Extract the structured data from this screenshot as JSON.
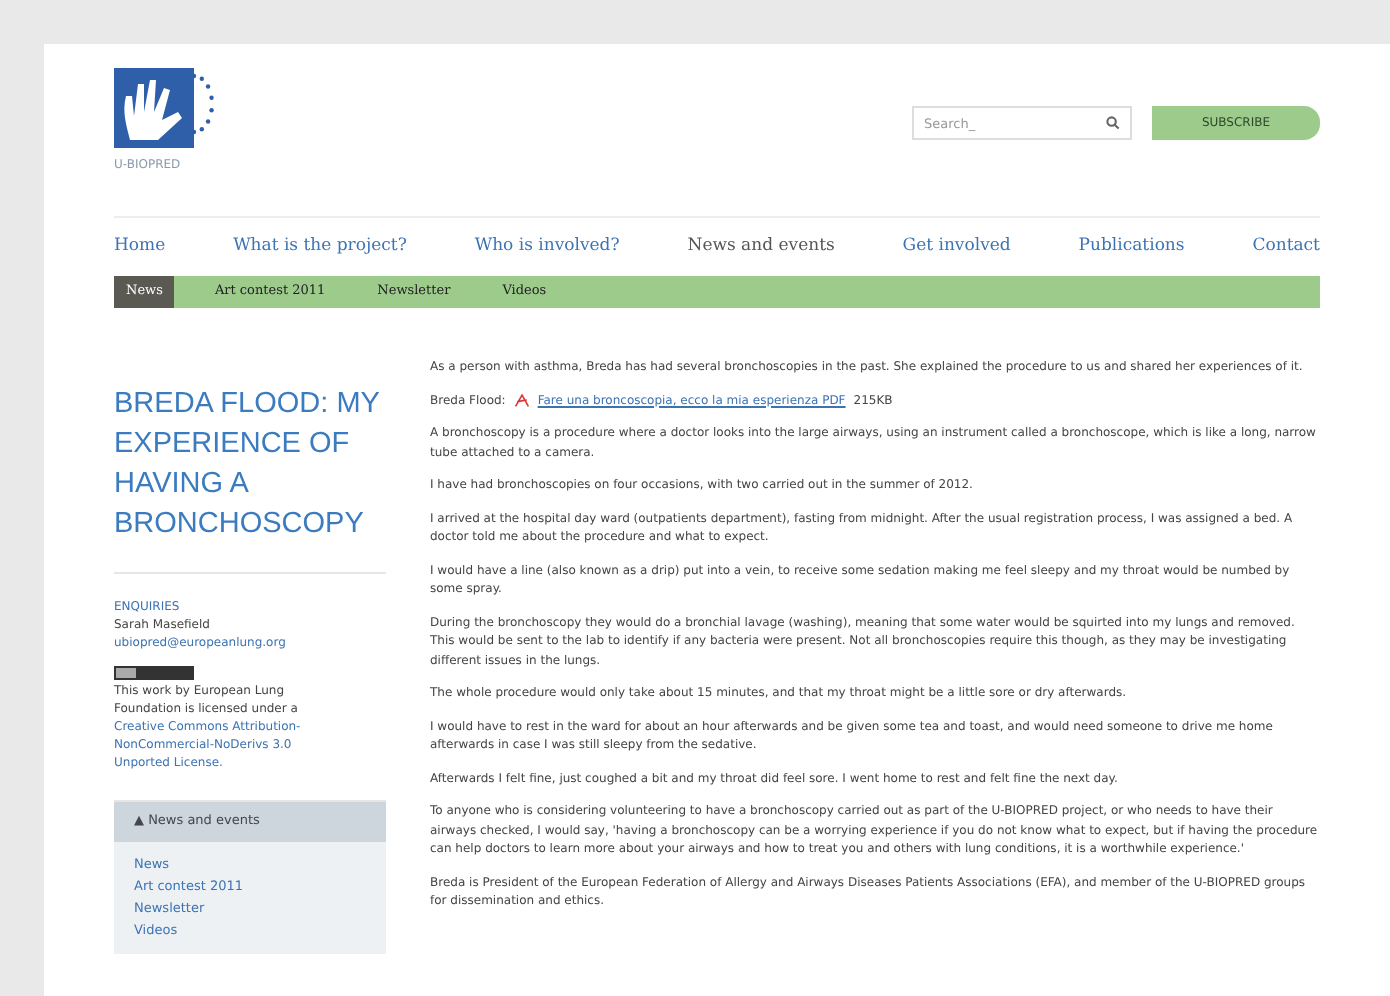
{
  "header": {
    "logo_text": "U-BIOPRED",
    "search": {
      "placeholder": "Search_"
    },
    "subscribe": "SUBSCRIBE"
  },
  "nav": [
    {
      "label": "Home",
      "selected": false
    },
    {
      "label": "What is the project?",
      "selected": false
    },
    {
      "label": "Who is involved?",
      "selected": false
    },
    {
      "label": "News and events",
      "selected": true
    },
    {
      "label": "Get involved",
      "selected": false
    },
    {
      "label": "Publications",
      "selected": false
    },
    {
      "label": "Contact",
      "selected": false
    }
  ],
  "subnav": [
    {
      "label": "News",
      "selected": true
    },
    {
      "label": "Art contest 2011",
      "selected": false
    },
    {
      "label": "Newsletter",
      "selected": false
    },
    {
      "label": "Videos",
      "selected": false
    }
  ],
  "sidebar": {
    "title": "BREDA FLOOD: MY EXPERIENCE OF HAVING A BRONCHOSCOPY",
    "enquiries": {
      "heading": "ENQUIRIES",
      "name": "Sarah Masefield",
      "email": "ubiopred@europeanlung.org"
    },
    "license": {
      "text": "This work by European Lung Foundation is licensed under a",
      "link": "Creative Commons Attribution-NonCommercial-NoDerivs 3.0 Unported License."
    },
    "menu": {
      "title": "▲  News and events",
      "items": [
        "News",
        "Art contest 2011",
        "Newsletter",
        "Videos"
      ]
    }
  },
  "article": [
    {
      "kind": "text",
      "text": "As a person with asthma, Breda has had several bronchoscopies in the past. She explained the procedure to us and shared her experiences of it."
    },
    {
      "kind": "file",
      "label": "Breda Flood:",
      "link": "Fare una broncoscopia, ecco la mia esperienza PDF",
      "size": "215KB"
    },
    {
      "kind": "text",
      "text": "A bronchoscopy is a procedure where a doctor looks into the large airways, using an instrument called a bronchoscope, which is like a long, narrow tube attached to a camera."
    },
    {
      "kind": "text",
      "text": "I have had bronchoscopies on four occasions, with two carried out in the summer of 2012."
    },
    {
      "kind": "text",
      "text": "I arrived at the hospital day ward (outpatients department), fasting from midnight. After the usual registration process, I was assigned a bed. A doctor told me about the procedure and what to expect."
    },
    {
      "kind": "text",
      "text": "I would have a line (also known as a drip) put into a vein, to receive some sedation making me feel sleepy and my throat would be numbed by some spray."
    },
    {
      "kind": "text",
      "text": "During the bronchoscopy they would do a bronchial lavage (washing), meaning that some water would be squirted into my lungs and removed. This would be sent to the lab to identify if any bacteria were present. Not all bronchoscopies require this though, as they may be investigating different issues in the lungs."
    },
    {
      "kind": "text",
      "text": "The whole procedure would only take about 15 minutes, and that my throat might be a little sore or dry afterwards."
    },
    {
      "kind": "text",
      "text": "I would have to rest in the ward for about an hour afterwards and be given some tea and toast, and would need someone to drive me home afterwards in case I was still sleepy from the sedative."
    },
    {
      "kind": "text",
      "text": "Afterwards I felt fine, just coughed a bit and my throat did feel sore. I went home to rest and felt fine the next day."
    },
    {
      "kind": "text",
      "text": "To anyone who is considering volunteering to have a bronchoscopy carried out as part of the U-BIOPRED project, or who needs to have their airways checked, I would say, 'having a bronchoscopy can be a worrying experience if you do not know what to expect, but if having the procedure can help doctors to learn more about your airways and how to treat you and others with lung conditions, it is a worthwhile experience.'"
    },
    {
      "kind": "text",
      "text": "Breda is President of the European Federation of Allergy and Airways Diseases Patients Associations (EFA), and member of the U-BIOPRED groups for dissemination and ethics."
    }
  ]
}
